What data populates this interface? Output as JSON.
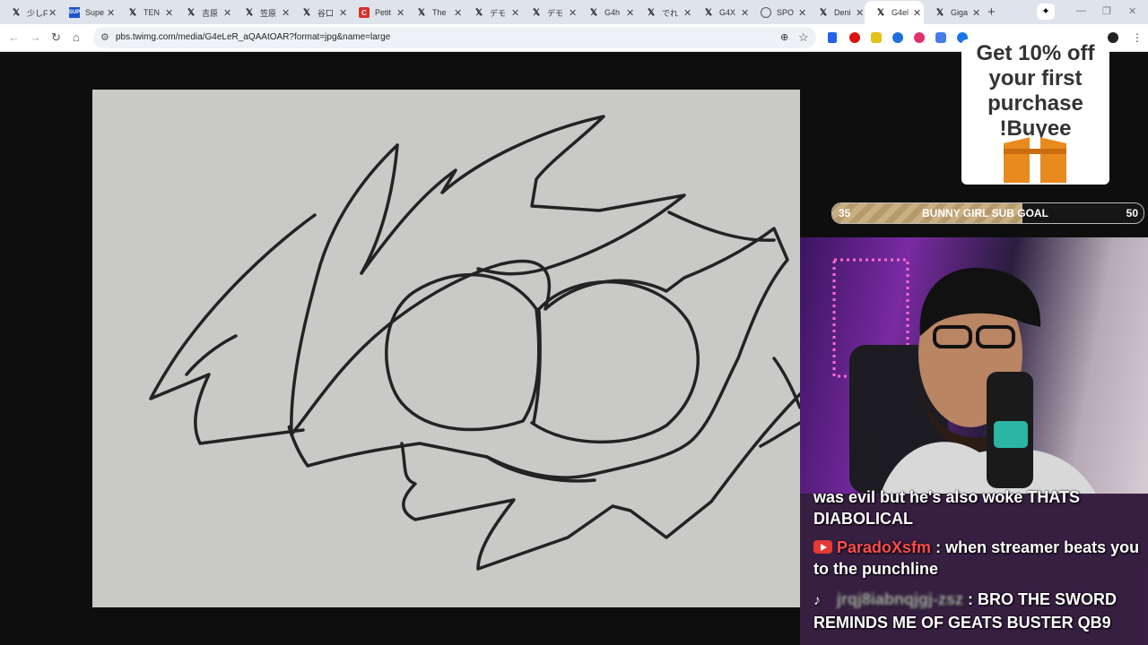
{
  "browser": {
    "tabs": [
      {
        "title": "少しF",
        "favicon": "x-icon"
      },
      {
        "title": "Supe",
        "favicon": "site-icon"
      },
      {
        "title": "TEN",
        "favicon": "x-icon"
      },
      {
        "title": "吉原",
        "favicon": "x-icon"
      },
      {
        "title": "笠原",
        "favicon": "x-icon"
      },
      {
        "title": "谷口",
        "favicon": "x-icon"
      },
      {
        "title": "Petit",
        "favicon": "petition-icon"
      },
      {
        "title": "The",
        "favicon": "x-icon"
      },
      {
        "title": "デモ",
        "favicon": "x-icon"
      },
      {
        "title": "デモ",
        "favicon": "x-icon"
      },
      {
        "title": "G4h",
        "favicon": "x-icon"
      },
      {
        "title": "でれ",
        "favicon": "x-icon"
      },
      {
        "title": "G4X",
        "favicon": "x-icon"
      },
      {
        "title": "SPO",
        "favicon": "globe-icon"
      },
      {
        "title": "Deni",
        "favicon": "x-icon"
      },
      {
        "title": "G4el",
        "favicon": "x-icon",
        "active": true
      },
      {
        "title": "Giga",
        "favicon": "x-icon"
      }
    ],
    "new_tab": "+",
    "url": "pbs.twimg.com/media/G4eLeR_aQAAtOAR?format=jpg&name=large"
  },
  "overlay": {
    "ad": {
      "line1": "Get 10% off",
      "line2": "your first",
      "line3": "purchase",
      "line4": "!Buyee"
    },
    "goal": {
      "start": "35",
      "label": "BUNNY GIRL SUB GOAL",
      "end": "50",
      "progress_fraction": 0.61
    },
    "chat": [
      {
        "platform": "",
        "user": "",
        "text": "was evil but he's also woke THATS DIABOLICAL"
      },
      {
        "platform": "youtube-icon",
        "user": "ParadoXsfm",
        "text": ": when streamer beats you to the punchline"
      },
      {
        "platform": "tiktok-icon",
        "user": "jrqj8iabnqjgj-zsz",
        "text": ": BRO THE SWORD REMINDS ME OF GEATS BUSTER QB9"
      }
    ]
  },
  "colors": {
    "youtube_red": "#e53935",
    "username_red": "#ff4d4d",
    "goal_fill": "#b59a6c"
  }
}
